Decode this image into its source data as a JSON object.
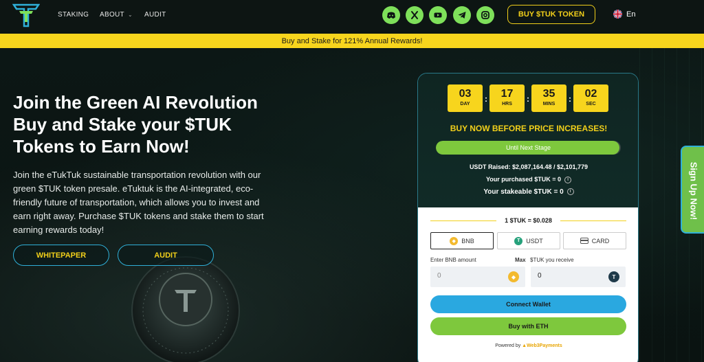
{
  "nav": {
    "links": [
      {
        "label": "STAKING"
      },
      {
        "label": "ABOUT"
      },
      {
        "label": "AUDIT"
      }
    ],
    "socials": [
      "discord-icon",
      "x-icon",
      "youtube-icon",
      "telegram-icon",
      "instagram-icon"
    ],
    "buy_label": "BUY $TUK TOKEN",
    "lang": "En"
  },
  "banner": {
    "text": "Buy and Stake for 121% Annual Rewards!"
  },
  "hero": {
    "title_lines": [
      "Join the Green AI Revolution",
      "Buy and Stake your $TUK",
      "Tokens to Earn Now!"
    ],
    "description": "Join the eTukTuk sustainable transportation revolution with our green $TUK token presale. eTuktuk is the AI-integrated, eco-friendly future of transportation, which allows you to invest and earn right away. Purchase $TUK tokens and stake them to start earning rewards today!",
    "whitepaper_label": "WHITEPAPER",
    "audit_label": "AUDIT"
  },
  "widget": {
    "countdown": [
      {
        "value": "03",
        "label": "DAY"
      },
      {
        "value": "17",
        "label": "HRS"
      },
      {
        "value": "35",
        "label": "MINS"
      },
      {
        "value": "02",
        "label": "SEC"
      }
    ],
    "buy_now": "BUY NOW BEFORE PRICE INCREASES!",
    "progress_label": "Until Next Stage",
    "progress_fraction": 0.993,
    "raised": "USDT Raised: $2,087,164.48 / $2,101,779",
    "purchased": "Your purchased $TUK = 0",
    "stakeable": "Your stakeable $TUK = 0",
    "rate": "1 $TUK = $0.028",
    "tabs": [
      {
        "label": "BNB",
        "active": true
      },
      {
        "label": "USDT",
        "active": false
      },
      {
        "label": "CARD",
        "active": false
      }
    ],
    "enter_label": "Enter BNB amount",
    "max_label": "Max",
    "receive_label": "$TUK you receive",
    "amount_value": "0",
    "receive_value": "0",
    "connect_label": "Connect Wallet",
    "buy_eth_label": "Buy with ETH",
    "powered_by": "Powered by",
    "powered_brand": "Web3Payments"
  },
  "signup": {
    "label": "Sign Up Now!"
  },
  "colors": {
    "accent_yellow": "#f7d51d",
    "accent_green": "#7ec83d",
    "accent_blue": "#2aa8e0"
  }
}
